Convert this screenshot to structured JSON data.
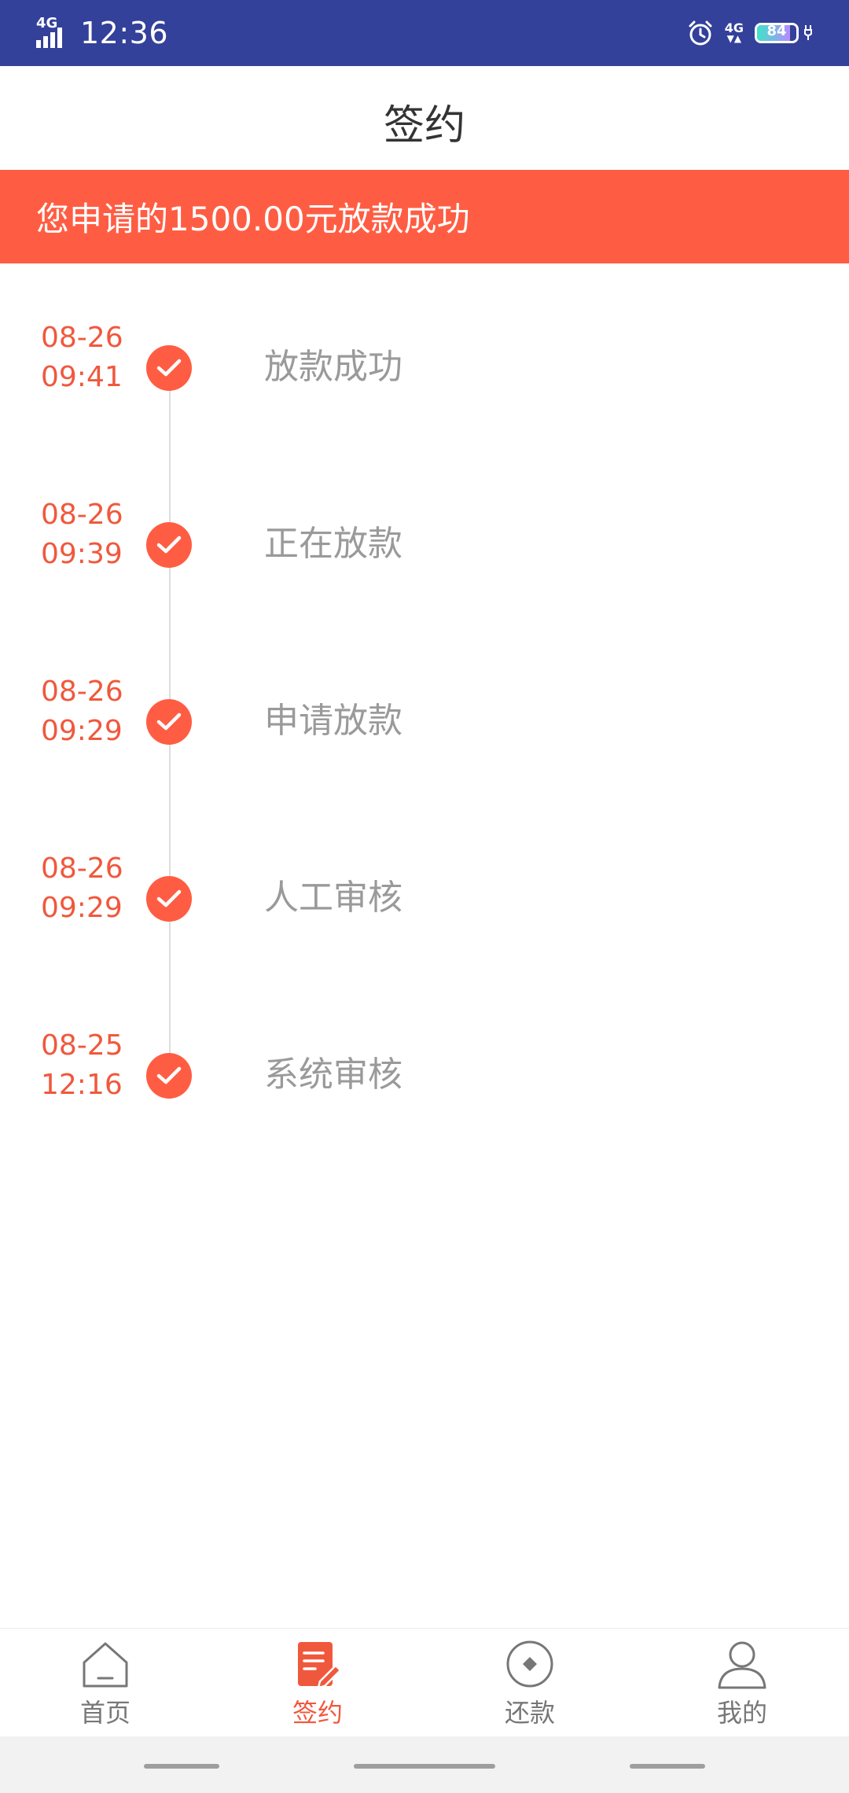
{
  "status_bar": {
    "time": "12:36",
    "signal_label": "4G",
    "network_label": "4G",
    "battery_level": "84",
    "battery_percent": 84
  },
  "header": {
    "title": "签约"
  },
  "banner": {
    "text": "您申请的1500.00元放款成功"
  },
  "timeline": [
    {
      "date": "08-26",
      "time": "09:41",
      "label": "放款成功"
    },
    {
      "date": "08-26",
      "time": "09:39",
      "label": "正在放款"
    },
    {
      "date": "08-26",
      "time": "09:29",
      "label": "申请放款"
    },
    {
      "date": "08-26",
      "time": "09:29",
      "label": "人工审核"
    },
    {
      "date": "08-25",
      "time": "12:16",
      "label": "系统审核"
    }
  ],
  "bottom_nav": [
    {
      "label": "首页",
      "icon": "home-icon",
      "active": false
    },
    {
      "label": "签约",
      "icon": "contract-icon",
      "active": true
    },
    {
      "label": "还款",
      "icon": "repay-icon",
      "active": false
    },
    {
      "label": "我的",
      "icon": "profile-icon",
      "active": false
    }
  ],
  "colors": {
    "status_bar": "#33419a",
    "accent": "#ff5d43",
    "date_text": "#f0583d",
    "label_text": "#9a9a9a",
    "nav_inactive": "#777777"
  }
}
